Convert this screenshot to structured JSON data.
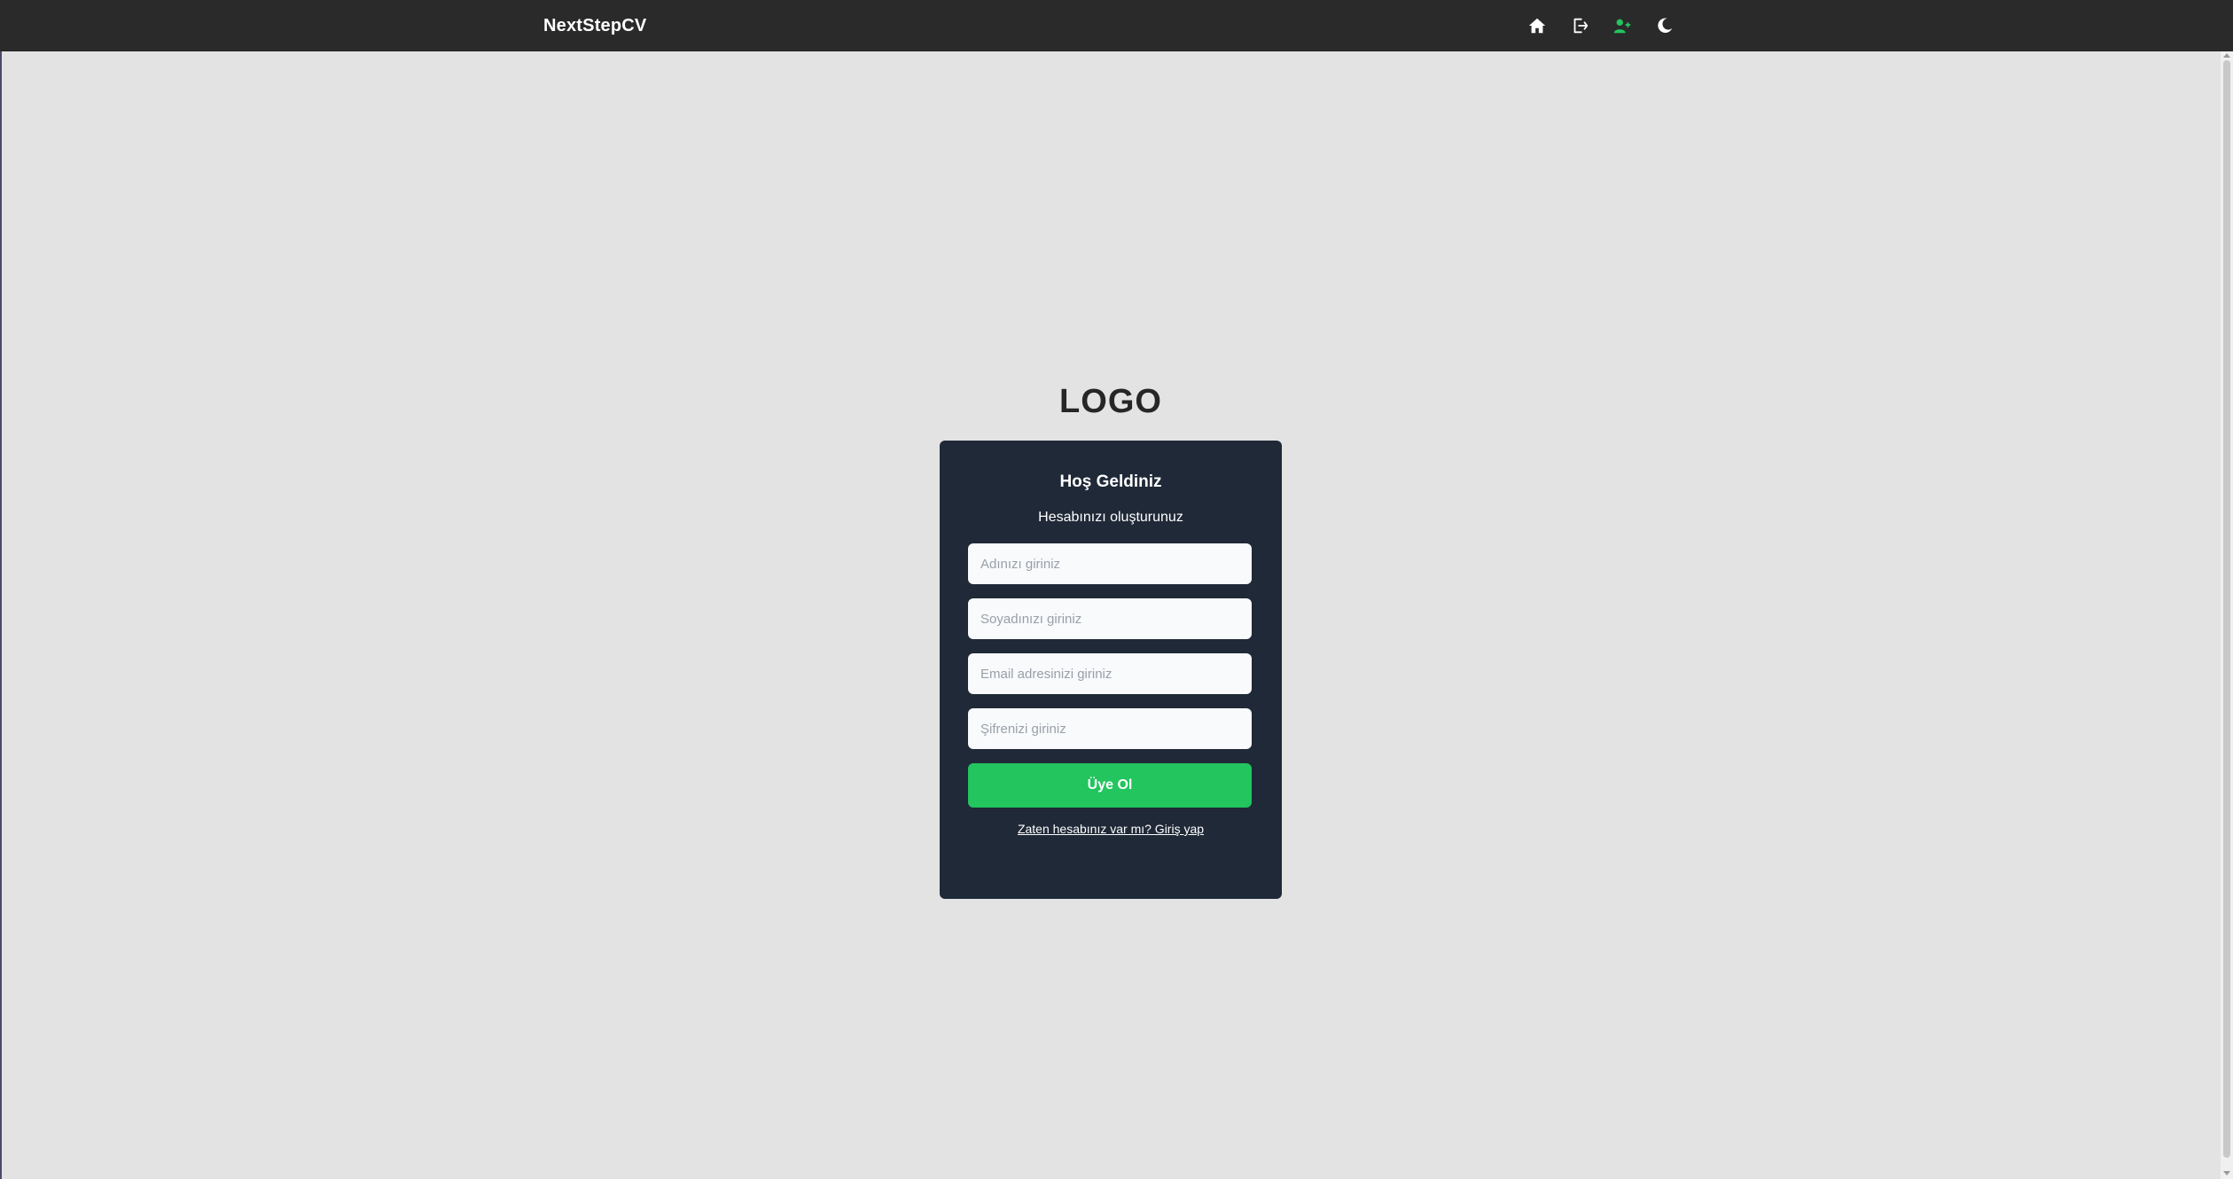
{
  "navbar": {
    "brand": "NextStepCV",
    "icons": [
      "home-icon",
      "logout-icon",
      "user-plus-icon",
      "moon-icon"
    ],
    "active_icon_color": "#22c55e"
  },
  "logo": {
    "text": "LOGO"
  },
  "form": {
    "title": "Hoş Geldiniz",
    "subtitle": "Hesabınızı oluşturunuz",
    "first_name_placeholder": "Adınızı giriniz",
    "last_name_placeholder": "Soyadınızı giriniz",
    "email_placeholder": "Email adresinizi giriniz",
    "password_placeholder": "Şifrenizi giriniz",
    "submit_label": "Üye Ol",
    "login_link": "Zaten hesabınız var mı? Giriş yap"
  },
  "colors": {
    "navbar_bg": "#2a2a2a",
    "page_bg": "#e3e3e3",
    "card_bg": "#1f2937",
    "accent": "#22c55e"
  }
}
